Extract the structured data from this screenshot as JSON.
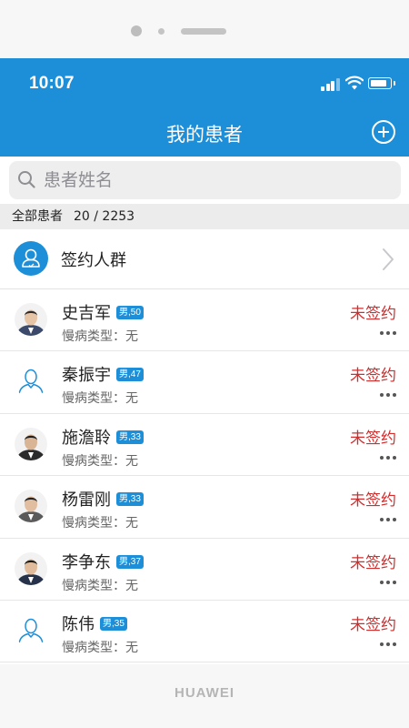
{
  "status_bar": {
    "time": "10:07"
  },
  "header": {
    "title": "我的患者",
    "add_icon": "plus-circle-icon"
  },
  "search": {
    "placeholder": "患者姓名",
    "value": "",
    "icon": "search-icon"
  },
  "summary": {
    "label": "全部患者",
    "count": "20 / 2253"
  },
  "group": {
    "label": "签约人群",
    "icon": "user-group-icon"
  },
  "patients": [
    {
      "name": "史吉军",
      "badge": "男,50",
      "chronic": "慢病类型：无",
      "status": "未签约",
      "avatar": "photo"
    },
    {
      "name": "秦振宇",
      "badge": "男,47",
      "chronic": "慢病类型：无",
      "status": "未签约",
      "avatar": "placeholder"
    },
    {
      "name": "施澹聆",
      "badge": "男,33",
      "chronic": "慢病类型：无",
      "status": "未签约",
      "avatar": "photo"
    },
    {
      "name": "杨雷刚",
      "badge": "男,33",
      "chronic": "慢病类型：无",
      "status": "未签约",
      "avatar": "photo"
    },
    {
      "name": "李争东",
      "badge": "男,37",
      "chronic": "慢病类型：无",
      "status": "未签约",
      "avatar": "photo"
    },
    {
      "name": "陈伟",
      "badge": "男,35",
      "chronic": "慢病类型：无",
      "status": "未签约",
      "avatar": "placeholder"
    }
  ],
  "device": {
    "brand": "HUAWEI"
  },
  "colors": {
    "primary": "#1d8fd9",
    "status_red": "#d22d2d"
  }
}
